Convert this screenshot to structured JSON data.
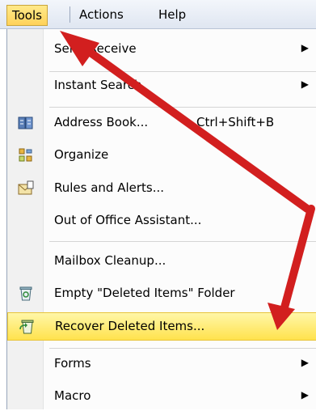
{
  "menubar": {
    "tools": "Tools",
    "actions": "Actions",
    "help": "Help"
  },
  "menu": {
    "items": [
      {
        "label": "Send/Receive",
        "has_submenu": true
      },
      {
        "label": "Instant Search",
        "has_submenu": true
      },
      {
        "label": "Address Book...",
        "shortcut": "Ctrl+Shift+B",
        "icon": "address-book-icon"
      },
      {
        "label": "Organize",
        "icon": "organize-icon"
      },
      {
        "label": "Rules and Alerts...",
        "icon": "rules-alerts-icon"
      },
      {
        "label": "Out of Office Assistant..."
      },
      {
        "label": "Mailbox Cleanup..."
      },
      {
        "label": "Empty \"Deleted Items\" Folder",
        "icon": "empty-trash-icon"
      },
      {
        "label": "Recover Deleted Items...",
        "icon": "recover-trash-icon",
        "highlighted": true
      },
      {
        "label": "Forms",
        "has_submenu": true
      },
      {
        "label": "Macro",
        "has_submenu": true
      }
    ]
  },
  "annotation_color": "#d21f1f",
  "highlight_color": "#ffe24d"
}
